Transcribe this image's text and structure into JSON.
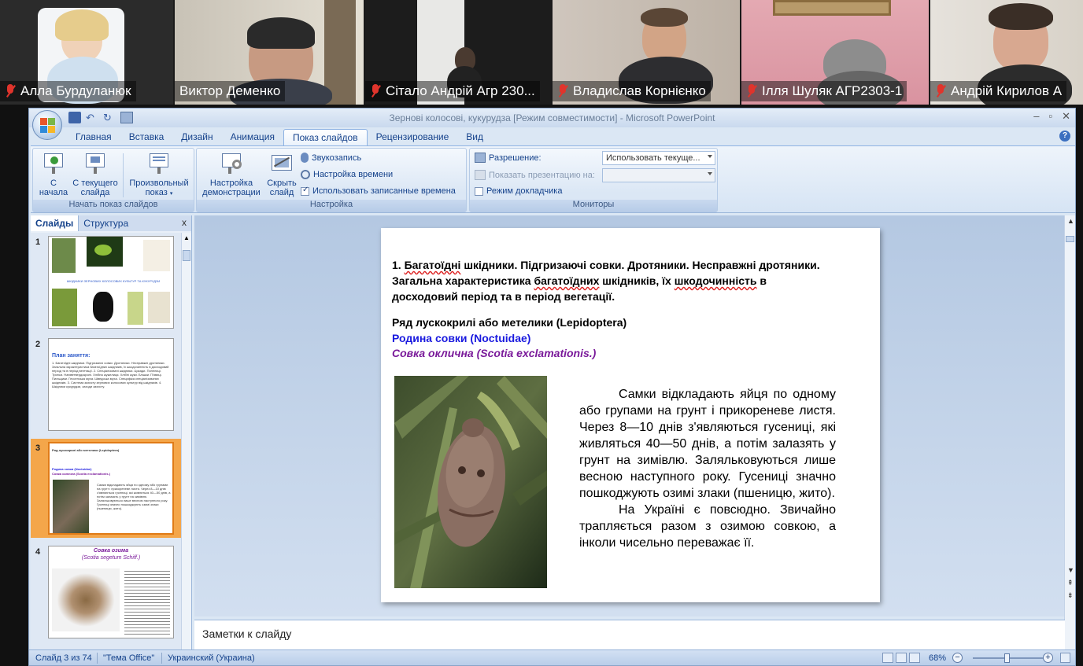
{
  "participants": [
    {
      "name": "Алла Бурдуланюк",
      "muted": true
    },
    {
      "name": "Виктор Деменко",
      "muted": false,
      "active": true
    },
    {
      "name": "Сітало Андрій Агр 230...",
      "muted": true
    },
    {
      "name": "Владислав Корнієнко",
      "muted": true
    },
    {
      "name": "Ілля Шуляк АГР2303-1",
      "muted": true
    },
    {
      "name": "Андрій Кирилов А",
      "muted": true
    }
  ],
  "window": {
    "title": "Зернові колосові, кукурудза [Режим совместимости] - Microsoft PowerPoint"
  },
  "tabs": [
    "Главная",
    "Вставка",
    "Дизайн",
    "Анимация",
    "Показ слайдов",
    "Рецензирование",
    "Вид"
  ],
  "active_tab": "Показ слайдов",
  "ribbon": {
    "group_start": {
      "label": "Начать показ слайдов",
      "btn_from_start": "С\nначала",
      "btn_from_start_l1": "С",
      "btn_from_start_l2": "начала",
      "btn_current_l1": "С текущего",
      "btn_current_l2": "слайда",
      "btn_custom_l1": "Произвольный",
      "btn_custom_l2": "показ"
    },
    "group_setup": {
      "label": "Настройка",
      "btn_setup_l1": "Настройка",
      "btn_setup_l2": "демонстрации",
      "btn_hide_l1": "Скрыть",
      "btn_hide_l2": "слайд",
      "record_narration": "Звукозапись",
      "rehearse_timings": "Настройка времени",
      "use_timings": "Использовать записанные времена"
    },
    "group_monitors": {
      "label": "Мониторы",
      "resolution_label": "Разрешение:",
      "resolution_value": "Использовать текуще...",
      "show_on_label": "Показать презентацию на:",
      "presenter_view": "Режим докладчика"
    }
  },
  "left_pane": {
    "tab_slides": "Слайды",
    "tab_outline": "Структура",
    "close": "x",
    "slides": [
      {
        "num": "1",
        "caption": "ШКІДНИКИ ЗЕРНОВИХ КОЛОСОВИХ КУЛЬТУР ТА КУКУРУДЗИ"
      },
      {
        "num": "2",
        "title": "План заняття:",
        "text": "1. Багатоїдні шкідники. Підгризаючі совки. Дротяники. Несправжні дротяники. Загальна характеристика багатоїдних шкідників, їх шкодочинність в досходовий період та в період вегетації. 2. Спеціалізовані шкідники. Цикади. Попелиці. Трипси. Напіветвердокрилі. Хлібна жужелиця. Хлібні жуки. Блішки. П'явиці. Пильщики. Гессенська муха. Шведська муха. Специфіка спеціалізованих шкідників. 3. Система захисту зернових колосових культур від шкідників. 4. Шкідники кукурудзи, заходи захисту."
      },
      {
        "num": "3",
        "selected": true
      },
      {
        "num": "4",
        "title": "Совка озима",
        "subtitle": "(Scotia segetum Schiff.)"
      }
    ]
  },
  "slide": {
    "heading_parts": [
      "1. ",
      "Багатоїдні",
      " шкідники. Підгризаючі совки. Дротяники. Несправжні дротяники.  Загальна характеристика ",
      "багатоїдних",
      " шкідників, їх ",
      "шкодочинність",
      " в досходовий період та в період вегетації."
    ],
    "order": "Ряд лускокрилі або метелики (Lepidoptera)",
    "family": "Родина совки  (Noctuidae)",
    "species": "Совка оклична  (Scotia    exclamationis.)",
    "body_p1": "Самки відкладають яйця по одному або групами на грунт і прикореневе листя. Через 8—10 днів з'являються гусениці, які живляться 40—50 днів, а потім залазять у грунт на зимівлю. Заляльковуються лише весною наступного року. Гусениці значно пошкоджують озимі злаки (пшеницю,                  жито).",
    "body_p2": "На Україні є повсюдно. Звичайно трапляється разом з озимою совкою, а інколи чисельно переважає її."
  },
  "notes_placeholder": "Заметки к слайду",
  "status": {
    "slide_of": "Слайд 3 из 74",
    "theme": "\"Тема Office\"",
    "language": "Украинский (Украина)",
    "zoom": "68%"
  },
  "colors": {
    "family": "#1a1adf",
    "species": "#7a1a9a",
    "active_speaker": "#2ecc40",
    "muted_mic": "#e0342c",
    "selected_thumb": "#f4a64a"
  }
}
